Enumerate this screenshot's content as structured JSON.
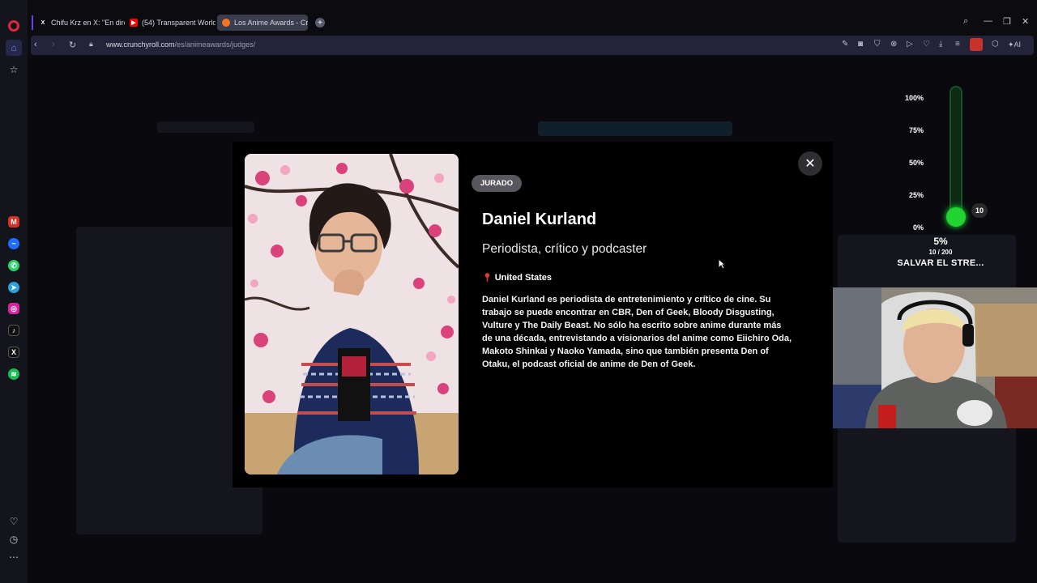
{
  "browser": {
    "tabs": [
      {
        "label": "Chifu Krz en X: \"En directo",
        "icon": "x-icon"
      },
      {
        "label": "(54) Transparent World – A",
        "icon": "youtube-icon"
      },
      {
        "label": "Los Anime Awards - Crunc",
        "icon": "crunchyroll-icon"
      }
    ],
    "url_host": "www.crunchyroll.com",
    "url_path": "/es/animeawards/judges/",
    "ai_label": "AI"
  },
  "modal": {
    "badge": "JURADO",
    "name": "Daniel Kurland",
    "role": "Periodista, crítico y podcaster",
    "location": "United States",
    "bio": "Daniel Kurland es periodista de entretenimiento y crítico de cine. Su trabajo se puede encontrar en CBR, Den of Geek, Bloody Disgusting, Vulture y The Daily Beast. No sólo ha escrito sobre anime durante más de una década, entrevistando a visionarios del anime como Eiichiro Oda, Makoto Shinkai y Naoko Yamada, sino que también presenta Den of Otaku, el podcast oficial de anime de Den of Geek."
  },
  "gauge": {
    "scale": [
      "100%",
      "75%",
      "50%",
      "25%",
      "0%"
    ],
    "count": "10",
    "percent": "5%",
    "progress": "10 / 200",
    "label": "SALVAR EL STRE...",
    "fill_fraction": 0.05,
    "color": "#21d431"
  }
}
